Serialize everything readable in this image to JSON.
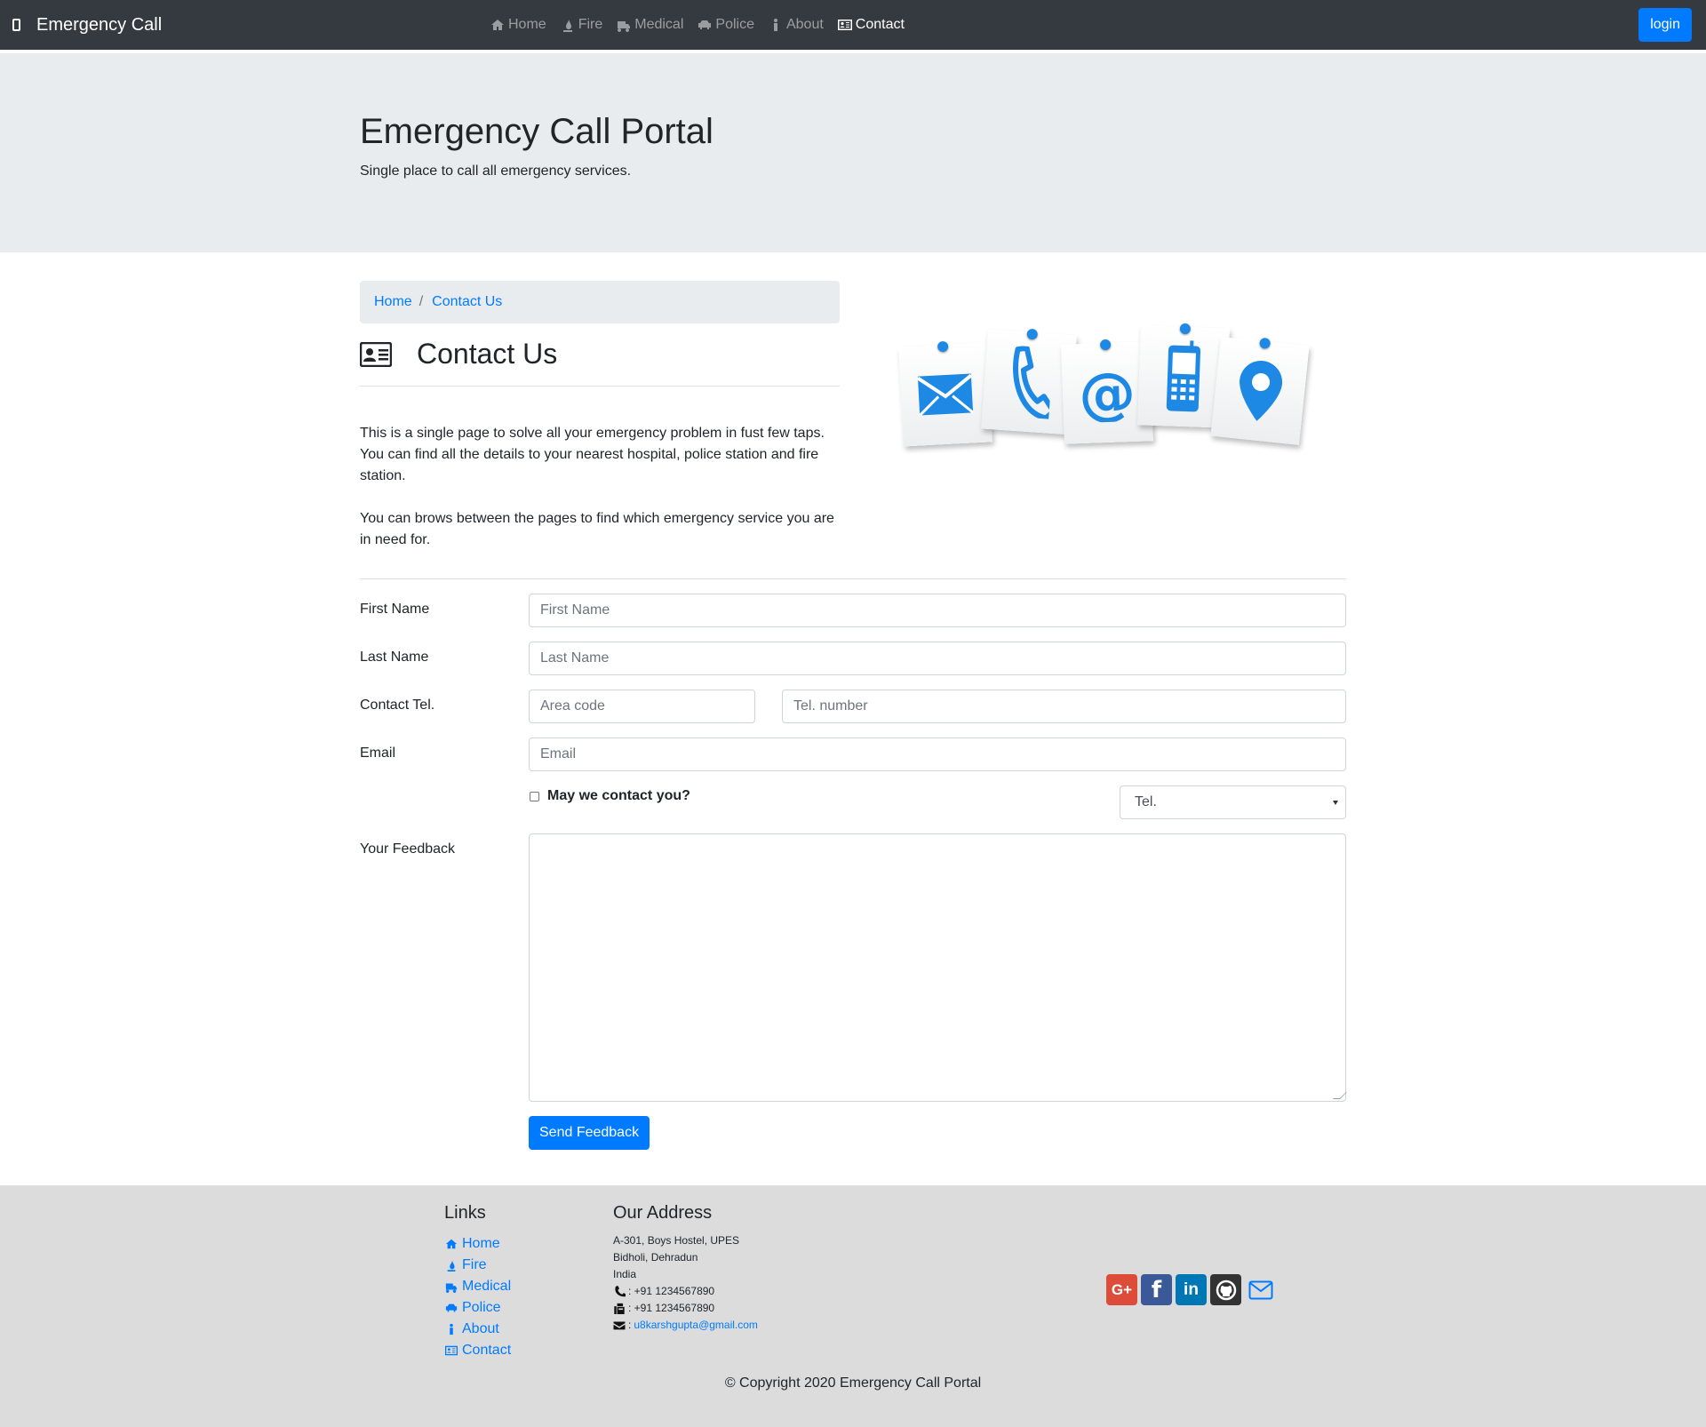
{
  "navbar": {
    "brand": "Emergency Call",
    "items": [
      {
        "label": "Home",
        "icon": "home-icon"
      },
      {
        "label": "Fire",
        "icon": "fire-icon"
      },
      {
        "label": "Medical",
        "icon": "ambulance-icon"
      },
      {
        "label": "Police",
        "icon": "car-icon"
      },
      {
        "label": "About",
        "icon": "info-icon"
      },
      {
        "label": "Contact",
        "icon": "contact-card-icon"
      }
    ],
    "login_label": "login"
  },
  "jumbotron": {
    "title": "Emergency Call Portal",
    "subtitle": "Single place to call all emergency services."
  },
  "breadcrumb": {
    "home": "Home",
    "current": "Contact Us"
  },
  "contact": {
    "heading": "Contact Us",
    "paragraph1": "This is a single page to solve all your emergency problem in fust few taps. You can find all the details to your nearest hospital, police station and fire station.",
    "paragraph2": "You can brows between the pages to find which emergency service you are in need for."
  },
  "form": {
    "first_name_label": "First Name",
    "first_name_placeholder": "First Name",
    "last_name_label": "Last Name",
    "last_name_placeholder": "Last Name",
    "tel_label": "Contact Tel.",
    "area_code_placeholder": "Area code",
    "tel_number_placeholder": "Tel. number",
    "email_label": "Email",
    "email_placeholder": "Email",
    "contact_checkbox_label": "May we contact you?",
    "contact_method_selected": "Tel.",
    "feedback_label": "Your Feedback",
    "send_label": "Send Feedback"
  },
  "footer": {
    "links_heading": "Links",
    "links": [
      "Home",
      "Fire",
      "Medical",
      "Police",
      "About",
      "Contact"
    ],
    "address_heading": "Our Address",
    "address_line1": "A-301, Boys Hostel, UPES",
    "address_line2": "Bidholi, Dehradun",
    "address_line3": "India",
    "phone": ": +91 1234567890",
    "fax": ": +91 1234567890",
    "email": "u8karshgupta@gmail.com",
    "copyright": "© Copyright 2020 Emergency Call Portal"
  },
  "colors": {
    "navbar": "#343a40",
    "primary": "#007bff",
    "jumbotron": "#e9ecef",
    "footer": "#dcdcdc",
    "google": "#dd4b39",
    "facebook": "#3b5998",
    "linkedin": "#0077b5",
    "github": "#333333"
  }
}
